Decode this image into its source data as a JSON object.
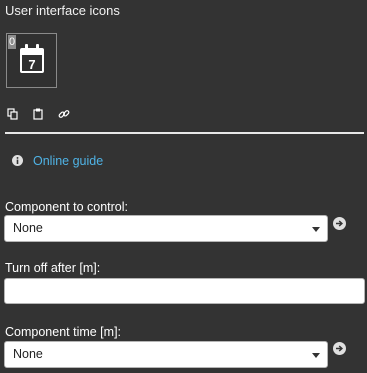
{
  "section": {
    "title": "User interface icons"
  },
  "icon_tile": {
    "badge": "0",
    "calendar_day": "7",
    "icon": "calendar-icon"
  },
  "toolbar": {
    "icons": [
      "copy-icon",
      "paste-icon",
      "link-icon"
    ]
  },
  "guide": {
    "icon": "info-icon",
    "label": "Online guide"
  },
  "fields": {
    "component_to_control": {
      "label": "Component to control:",
      "value": "None"
    },
    "turn_off_after": {
      "label": "Turn off after [m]:",
      "value": ""
    },
    "component_time": {
      "label": "Component time [m]:",
      "value": "None"
    }
  },
  "colors": {
    "background": "#333333",
    "link": "#4fb3e6",
    "divider": "#e8e8e8",
    "input_background": "#ffffff"
  }
}
